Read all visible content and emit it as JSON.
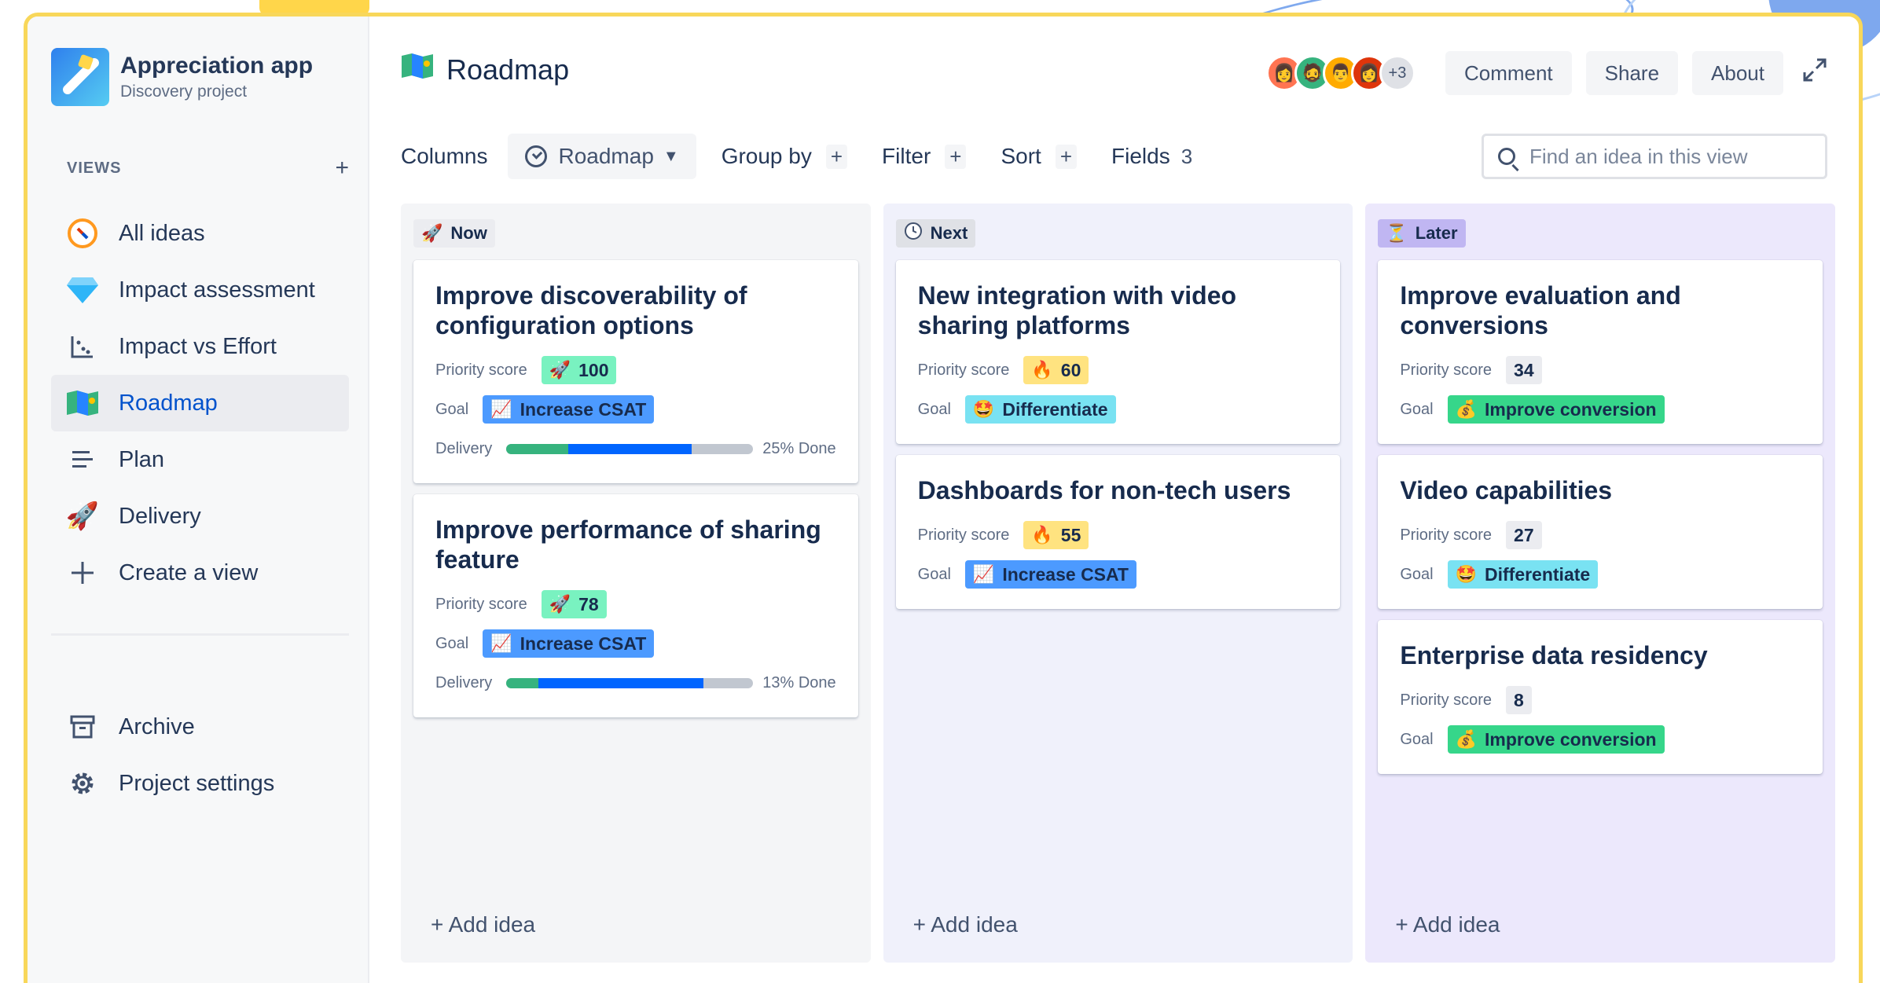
{
  "project": {
    "name": "Appreciation app",
    "subtitle": "Discovery project"
  },
  "sidebar": {
    "views_header": "VIEWS",
    "add_view": "+",
    "items": [
      {
        "label": "All ideas",
        "icon": "compass-icon"
      },
      {
        "label": "Impact assessment",
        "icon": "diamond-icon"
      },
      {
        "label": "Impact vs Effort",
        "icon": "scatter-chart-icon"
      },
      {
        "label": "Roadmap",
        "icon": "map-icon",
        "active": true
      },
      {
        "label": "Plan",
        "icon": "list-icon"
      },
      {
        "label": "Delivery",
        "icon": "rocket-icon"
      },
      {
        "label": "Create a view",
        "icon": "plus-icon"
      }
    ],
    "bottom_items": [
      {
        "label": "Archive",
        "icon": "archive-icon"
      },
      {
        "label": "Project settings",
        "icon": "gear-icon"
      }
    ]
  },
  "header": {
    "title": "Roadmap",
    "avatars_more": "+3",
    "buttons": {
      "comment": "Comment",
      "share": "Share",
      "about": "About"
    }
  },
  "toolbar": {
    "columns_label": "Columns",
    "columns_value": "Roadmap",
    "group_by": "Group by",
    "filter": "Filter",
    "sort": "Sort",
    "fields": "Fields",
    "fields_count": "3",
    "plus": "+",
    "search_placeholder": "Find an idea in this view"
  },
  "labels": {
    "priority": "Priority score",
    "goal": "Goal",
    "delivery": "Delivery",
    "add_idea": "+ Add idea"
  },
  "colors": {
    "accent": "#0052cc",
    "frame": "#f8d75a",
    "now_bg": "#f4f5f7",
    "next_bg": "#f0f1fb",
    "later_bg": "#ece8fc"
  },
  "columns": [
    {
      "name": "Now",
      "icon": "rocket-icon",
      "cards": [
        {
          "title": "Improve discoverability of configuration options",
          "priority": "100",
          "priority_icon": "rocket-icon",
          "goal": "Increase CSAT",
          "goal_icon": "chart-up-icon",
          "delivery_done": 0.25,
          "delivery_progress": 0.75,
          "delivery_text": "25% Done"
        },
        {
          "title": "Improve performance of sharing feature",
          "priority": "78",
          "priority_icon": "rocket-icon",
          "goal": "Increase CSAT",
          "goal_icon": "chart-up-icon",
          "delivery_done": 0.13,
          "delivery_progress": 0.8,
          "delivery_text": "13% Done"
        }
      ]
    },
    {
      "name": "Next",
      "icon": "clock-icon",
      "cards": [
        {
          "title": "New integration with video sharing platforms",
          "priority": "60",
          "priority_icon": "fire-icon",
          "goal": "Differentiate",
          "goal_icon": "star-struck-icon"
        },
        {
          "title": "Dashboards for non-tech users",
          "priority": "55",
          "priority_icon": "fire-icon",
          "goal": "Increase CSAT",
          "goal_icon": "chart-up-icon"
        }
      ]
    },
    {
      "name": "Later",
      "icon": "hourglass-icon",
      "cards": [
        {
          "title": "Improve evaluation and conversions",
          "priority": "34",
          "goal": "Improve conversion",
          "goal_icon": "money-bag-icon"
        },
        {
          "title": "Video capabilities",
          "priority": "27",
          "goal": "Differentiate",
          "goal_icon": "star-struck-icon"
        },
        {
          "title": "Enterprise data residency",
          "priority": "8",
          "goal": "Improve conversion",
          "goal_icon": "money-bag-icon"
        }
      ]
    }
  ]
}
